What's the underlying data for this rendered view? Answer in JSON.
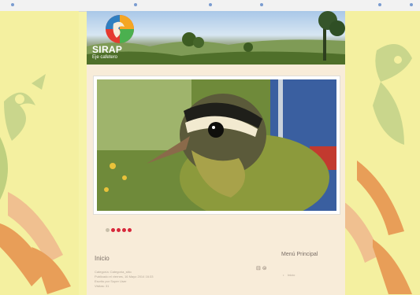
{
  "brand": {
    "name": "SIRAP",
    "tagline": "Eje cafetero"
  },
  "slider": {
    "dots": 5,
    "active_dot": 2
  },
  "article": {
    "title": "Inicio",
    "meta_lines": [
      "Categoría: Categoría_sitio",
      "Publicado el viernes, 16 Mayo 2014 16:33",
      "Escrito por Super User",
      "Visitas: 31"
    ],
    "tools_label": "⊟ ⊜"
  },
  "sidebar": {
    "title": "Menú Principal",
    "items": [
      {
        "label": "Inicio"
      }
    ]
  },
  "colors": {
    "page_background": "#f6f3a9",
    "column_background": "#f8ecd9",
    "active_dot": "#d7283b"
  }
}
